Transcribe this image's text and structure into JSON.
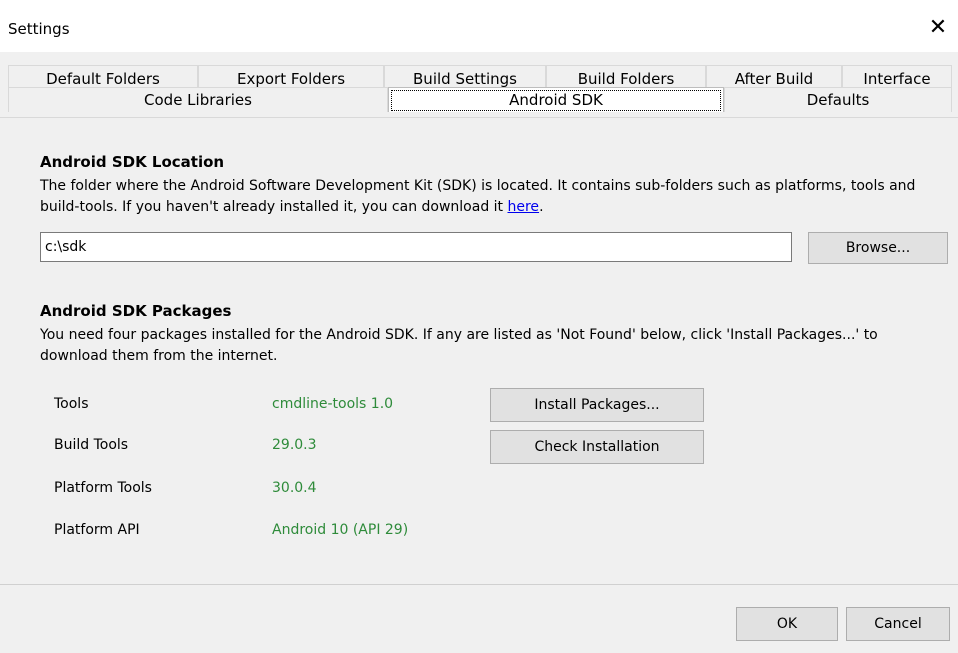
{
  "window": {
    "title": "Settings",
    "close_glyph": "✕"
  },
  "tabs": {
    "row1": [
      "Default Folders",
      "Export Folders",
      "Build Settings",
      "Build Folders",
      "After Build",
      "Interface"
    ],
    "row2": [
      "Code Libraries",
      "Android SDK",
      "Defaults"
    ],
    "selected": "Android SDK"
  },
  "sdk_location": {
    "heading": "Android SDK Location",
    "description": "The folder where the Android Software Development Kit (SDK) is located. It contains sub-folders such as platforms, tools and build-tools. If you haven't already installed it, you can download it ",
    "link_text": "here",
    "description_end": ".",
    "path_value": "c:\\sdk",
    "browse_label": "Browse..."
  },
  "sdk_packages": {
    "heading": "Android SDK Packages",
    "description": "You need four packages installed for the Android SDK. If any are listed as 'Not Found' below, click 'Install Packages...' to download them from the internet.",
    "rows": [
      {
        "label": "Tools",
        "value": "cmdline-tools 1.0"
      },
      {
        "label": "Build Tools",
        "value": "29.0.3"
      },
      {
        "label": "Platform Tools",
        "value": "30.0.4"
      },
      {
        "label": "Platform API",
        "value": "Android 10 (API 29)"
      }
    ],
    "install_label": "Install Packages...",
    "check_label": "Check Installation",
    "found_color": "#2e8b3a"
  },
  "footer": {
    "ok_label": "OK",
    "cancel_label": "Cancel"
  }
}
